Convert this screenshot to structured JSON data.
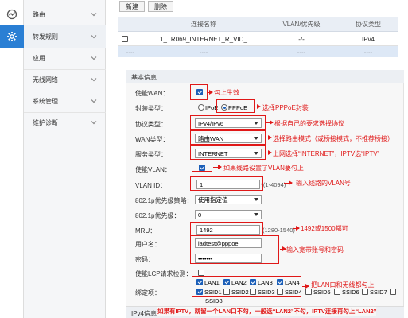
{
  "sidebar": {
    "items": [
      {
        "label": "路由"
      },
      {
        "label": "转发规则"
      },
      {
        "label": "应用"
      },
      {
        "label": "无线网络"
      },
      {
        "label": "系统管理"
      },
      {
        "label": "维护诊断"
      }
    ]
  },
  "toolbar": {
    "new_label": "新建",
    "delete_label": "删除"
  },
  "table": {
    "headers": [
      "连接名称",
      "VLAN/优先级",
      "协议类型"
    ],
    "rows": [
      [
        "1_TR069_INTERNET_R_VID_",
        "-/-",
        "IPv4"
      ],
      [
        "----",
        "----",
        "----"
      ]
    ],
    "extra_first_col": "----"
  },
  "form": {
    "section_title": "基本信息",
    "enable_wan": {
      "label": "使能WAN："
    },
    "encap": {
      "label": "封装类型：",
      "option_ipoe": "IPoE",
      "option_pppoe": "PPPoE"
    },
    "protocol": {
      "label": "协议类型：",
      "value": "IPv4/IPv6"
    },
    "wan_type": {
      "label": "WAN类型：",
      "value": "路由WAN"
    },
    "service_type": {
      "label": "服务类型：",
      "value": "INTERNET"
    },
    "enable_vlan": {
      "label": "使能VLAN："
    },
    "vlan_id": {
      "label": "VLAN ID：",
      "value": "1",
      "hint": "*(1-4094)"
    },
    "priority_policy": {
      "label": "802.1p优先级策略：",
      "value": "使用指定值"
    },
    "priority": {
      "label": "802.1p优先级：",
      "value": "0"
    },
    "mru": {
      "label": "MRU：",
      "value": "1492",
      "hint": "(1280-1540)"
    },
    "username": {
      "label": "用户名：",
      "value": "iadtest@pppoe"
    },
    "password": {
      "label": "密码：",
      "value": "•••••••"
    },
    "lcp": {
      "label": "使能LCP请求检测："
    },
    "binding": {
      "label": "绑定项：",
      "lan": [
        "LAN1",
        "LAN2",
        "LAN3",
        "LAN4"
      ],
      "ssid_row": [
        "SSID1",
        "SSID2",
        "SSID3",
        "SSID4",
        "SSID5",
        "SSID6",
        "SSID7"
      ],
      "ssid_last": "SSID8"
    },
    "ipv4_section": "IPv4信息"
  },
  "annotations": {
    "a1": "勾上生效",
    "a2": "选择PPPoE封装",
    "a3": "根据自己的要求选择协议",
    "a4": "选择路由模式（或桥接模式，不推荐桥接）",
    "a5": "上网选择“INTERNET”，IPTV选“IPTV”",
    "a6": "如果线路设置了VLAN要勾上",
    "a7": "输入线路的VLAN号",
    "a8": "1492或1500都可",
    "a9": "输入宽带账号和密码",
    "a10": "把LAN口和无线都勾上",
    "a11": "如果有IPTV，就留一个LAN口不勾，一般选“LAN2”不勾，IPTV连接再勾上“LAN2”"
  },
  "colors": {
    "accent": "#2a7fd4",
    "annotation": "#e01818",
    "checkbox": "#1c5fb8"
  }
}
